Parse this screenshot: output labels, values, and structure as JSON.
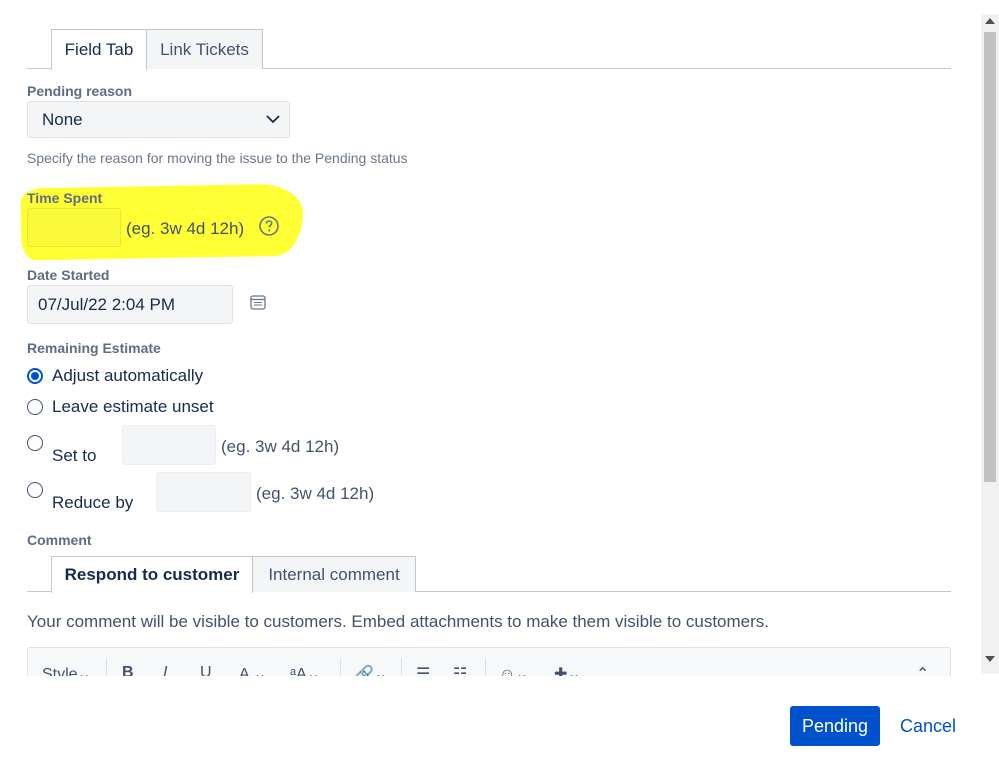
{
  "tabs": [
    {
      "label": "Field Tab",
      "active": true
    },
    {
      "label": "Link Tickets",
      "active": false
    }
  ],
  "pending_reason": {
    "label": "Pending reason",
    "selected": "None",
    "help": "Specify the reason for moving the issue to the Pending status"
  },
  "time_spent": {
    "label": "Time Spent",
    "value": "",
    "example": "(eg. 3w 4d 12h)"
  },
  "date_started": {
    "label": "Date Started",
    "value": "07/Jul/22 2:04 PM"
  },
  "remaining_estimate": {
    "label": "Remaining Estimate",
    "options": [
      {
        "label": "Adjust automatically",
        "checked": true
      },
      {
        "label": "Leave estimate unset",
        "checked": false
      },
      {
        "label": "Set to",
        "checked": false,
        "example": "(eg. 3w 4d 12h)"
      },
      {
        "label": "Reduce by",
        "checked": false,
        "example": "(eg. 3w 4d 12h)"
      }
    ]
  },
  "comment": {
    "label": "Comment",
    "tabs": [
      {
        "label": "Respond to customer",
        "active": true
      },
      {
        "label": "Internal comment",
        "active": false
      }
    ],
    "info": "Your comment will be visible to customers. Embed attachments to make them visible to customers.",
    "toolbar": {
      "style": "Style",
      "bold": "B",
      "italic": "I",
      "underline": "U",
      "text_color": "A",
      "more_format": "ᵃA"
    }
  },
  "footer": {
    "primary": "Pending",
    "cancel": "Cancel"
  },
  "colors": {
    "primary": "#0052cc",
    "highlight": "#ffff33"
  }
}
